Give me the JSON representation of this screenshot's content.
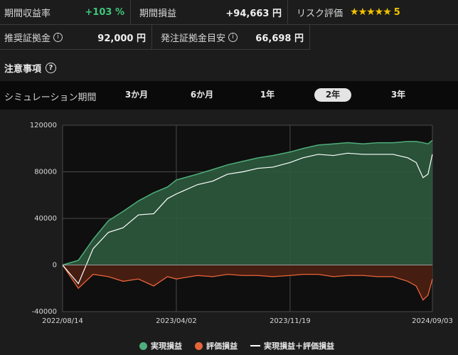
{
  "stats": {
    "period_return_label": "期間収益率",
    "period_return_value": "+103 %",
    "period_pnl_label": "期間損益",
    "period_pnl_value": "+94,663 円",
    "risk_label": "リスク評価",
    "risk_stars": "★★★★★",
    "risk_value": "5",
    "recommended_margin_label": "推奨証拠金",
    "recommended_margin_value": "92,000 円",
    "order_margin_label": "発注証拠金目安",
    "order_margin_value": "66,698 円"
  },
  "notice": {
    "label": "注意事項",
    "icon": "question-circle-icon"
  },
  "period": {
    "label": "シミュレーション期間",
    "options": [
      "3か月",
      "6か月",
      "1年",
      "2年",
      "3年"
    ],
    "selected": "2年"
  },
  "chart_data": {
    "type": "area",
    "title": "",
    "xlabel": "",
    "ylabel": "",
    "ylim": [
      -40000,
      120000
    ],
    "yticks": [
      "120000",
      "80000",
      "40000",
      "0",
      "-40000"
    ],
    "xticks": [
      "2022/08/14",
      "2023/04/02",
      "2023/11/19",
      "2024/09/03"
    ],
    "x_dates": [
      "2022/08/14",
      "2022/09/15",
      "2022/10/15",
      "2022/11/15",
      "2022/12/15",
      "2023/01/15",
      "2023/02/15",
      "2023/03/15",
      "2023/04/02",
      "2023/05/15",
      "2023/06/15",
      "2023/07/15",
      "2023/08/15",
      "2023/09/15",
      "2023/10/15",
      "2023/11/19",
      "2023/12/15",
      "2024/01/15",
      "2024/02/15",
      "2024/03/15",
      "2024/04/15",
      "2024/05/15",
      "2024/06/15",
      "2024/07/15",
      "2024/08/01",
      "2024/08/15",
      "2024/08/25",
      "2024/09/03"
    ],
    "series": [
      {
        "name": "実現損益",
        "color": "#4fae7c",
        "values": [
          0,
          4000,
          22000,
          38000,
          46000,
          55000,
          62000,
          67000,
          73000,
          78000,
          82000,
          86000,
          89000,
          92000,
          94000,
          97000,
          100000,
          103000,
          104000,
          105000,
          104000,
          105000,
          105000,
          106000,
          106000,
          105000,
          104000,
          107000
        ]
      },
      {
        "name": "評価損益",
        "color": "#e8653a",
        "values": [
          0,
          -20000,
          -8000,
          -10000,
          -14000,
          -12000,
          -18000,
          -10000,
          -12000,
          -9000,
          -10000,
          -8000,
          -9000,
          -9000,
          -10000,
          -9000,
          -8000,
          -8000,
          -10000,
          -9000,
          -9000,
          -10000,
          -10000,
          -14000,
          -18000,
          -30000,
          -26000,
          -12000
        ]
      },
      {
        "name": "実現損益＋評価損益",
        "color": "#ffffff",
        "values": [
          0,
          -16000,
          14000,
          28000,
          32000,
          43000,
          44000,
          57000,
          61000,
          69000,
          72000,
          78000,
          80000,
          83000,
          84000,
          88000,
          92000,
          95000,
          94000,
          96000,
          95000,
          95000,
          95000,
          92000,
          88000,
          75000,
          78000,
          95000
        ]
      }
    ]
  },
  "legend": {
    "items": [
      {
        "label": "実現損益",
        "color": "#4fae7c"
      },
      {
        "label": "評価損益",
        "color": "#e8653a"
      },
      {
        "label": "実現損益＋評価損益",
        "color": "#ffffff"
      }
    ]
  }
}
